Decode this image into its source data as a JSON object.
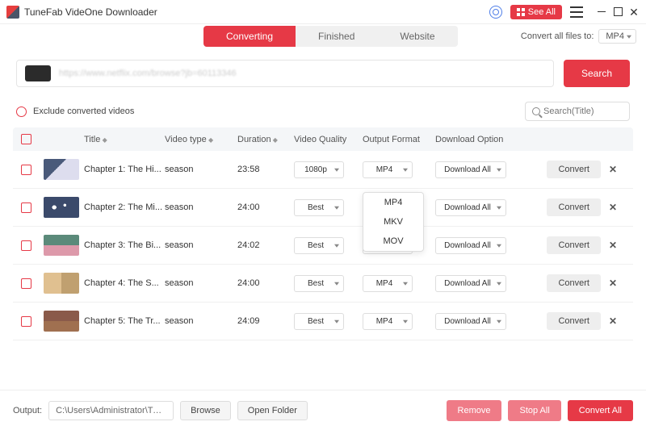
{
  "app": {
    "title": "TuneFab VideOne Downloader"
  },
  "titlebar": {
    "see_all": "See All"
  },
  "tabs": {
    "converting": "Converting",
    "finished": "Finished",
    "website": "Website"
  },
  "convert_all": {
    "label": "Convert all files to:",
    "value": "MP4"
  },
  "url_bar": {
    "value": "https://www.netflix.com/browse?jb=60113346"
  },
  "search_btn": "Search",
  "exclude_label": "Exclude converted videos",
  "title_search_placeholder": "Search(Title)",
  "headers": {
    "title": "Title",
    "video_type": "Video type",
    "duration": "Duration",
    "quality": "Video Quality",
    "format": "Output Format",
    "download": "Download Option"
  },
  "rows": [
    {
      "title": "Chapter 1: The Hi...",
      "type": "season",
      "duration": "23:58",
      "quality": "1080p",
      "format": "MP4",
      "download": "Download All",
      "convert": "Convert"
    },
    {
      "title": "Chapter 2: The Mi...",
      "type": "season",
      "duration": "24:00",
      "quality": "Best",
      "format": "MP4",
      "download": "Download All",
      "convert": "Convert"
    },
    {
      "title": "Chapter 3: The Bi...",
      "type": "season",
      "duration": "24:02",
      "quality": "Best",
      "format": "MP4",
      "download": "Download All",
      "convert": "Convert"
    },
    {
      "title": "Chapter 4: The S...",
      "type": "season",
      "duration": "24:00",
      "quality": "Best",
      "format": "MP4",
      "download": "Download All",
      "convert": "Convert"
    },
    {
      "title": "Chapter 5: The Tr...",
      "type": "season",
      "duration": "24:09",
      "quality": "Best",
      "format": "MP4",
      "download": "Download All",
      "convert": "Convert"
    }
  ],
  "format_options": [
    "MP4",
    "MKV",
    "MOV"
  ],
  "footer": {
    "output_label": "Output:",
    "output_path": "C:\\Users\\Administrator\\Tun...",
    "browse": "Browse",
    "open_folder": "Open Folder",
    "remove": "Remove",
    "stop_all": "Stop All",
    "convert_all": "Convert All"
  }
}
